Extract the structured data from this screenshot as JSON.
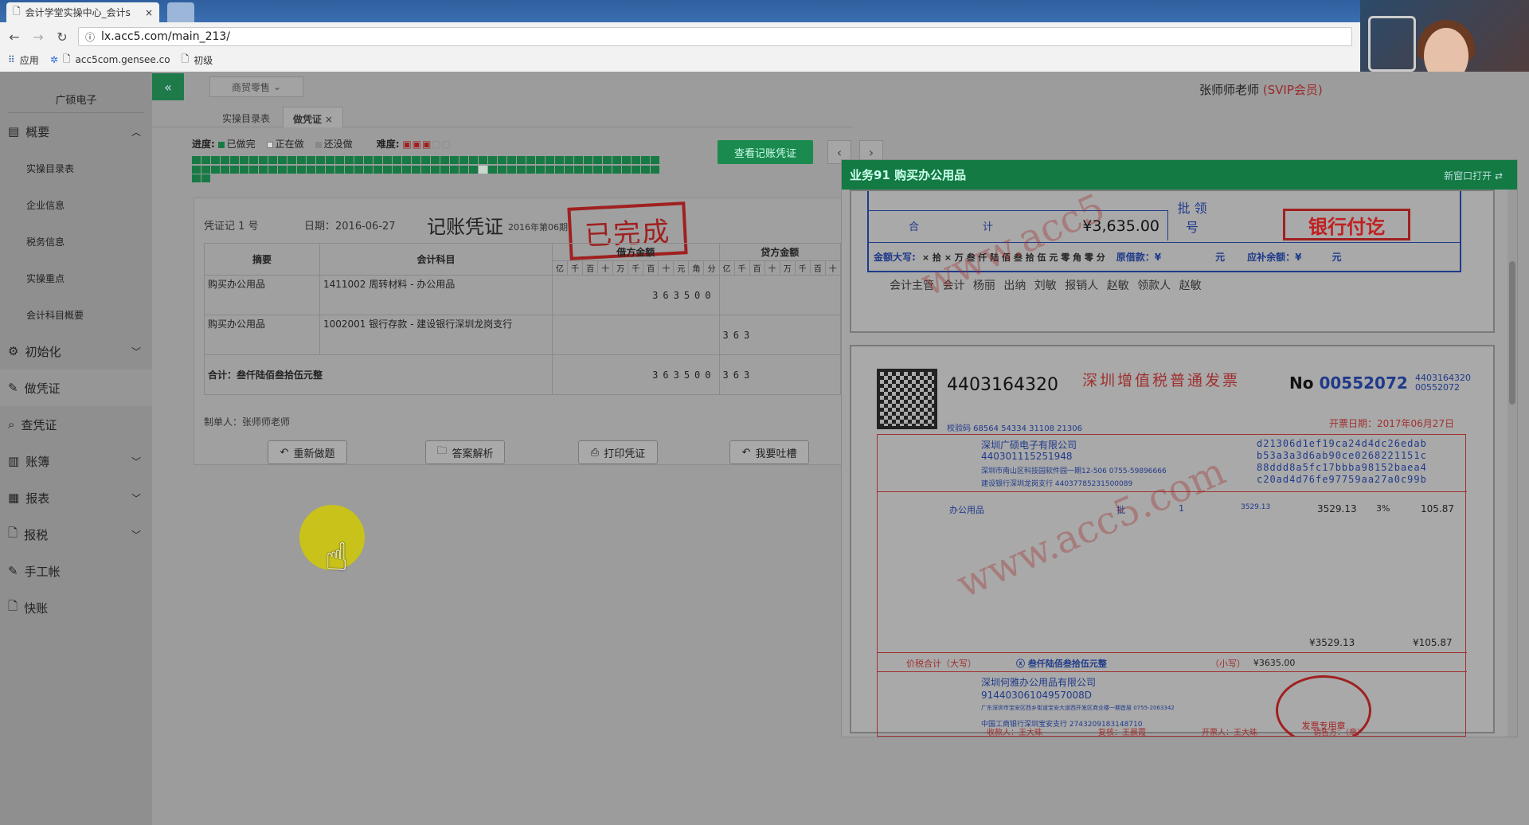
{
  "browser": {
    "tabs": [
      {
        "title": "会计学堂实操中心_会计s"
      }
    ],
    "url": "lx.acc5.com/main_213/",
    "bookmarks": [
      "应用",
      "acc5com.gensee.co",
      "初级"
    ]
  },
  "sidebar": {
    "brand": "广硕电子",
    "items": [
      {
        "label": "概要",
        "icon": "grid-icon",
        "expanded": true
      },
      {
        "label": "初始化",
        "icon": "gear-icon"
      },
      {
        "label": "做凭证",
        "icon": "pen-icon"
      },
      {
        "label": "查凭证",
        "icon": "search-icon"
      },
      {
        "label": "账簿",
        "icon": "book-icon"
      },
      {
        "label": "报表",
        "icon": "report-icon"
      },
      {
        "label": "报税",
        "icon": "file-icon"
      },
      {
        "label": "手工帐",
        "icon": "pen-icon"
      },
      {
        "label": "快账",
        "icon": "file-icon"
      }
    ],
    "sub_items": [
      "实操目录表",
      "企业信息",
      "税务信息",
      "实操重点",
      "会计科目概要"
    ]
  },
  "header": {
    "industry": "商贸零售",
    "teacher": "张师师老师",
    "vip": "(SVIP会员)"
  },
  "subtabs": [
    "实操目录表",
    "做凭证"
  ],
  "progress": {
    "label": "进度:",
    "done": "已做完",
    "doing": "正在做",
    "todo": "还没做",
    "difficulty_label": "难度:",
    "total_cells": 100,
    "current_cell": 79
  },
  "buttons": {
    "view_voucher": "查看记账凭证",
    "redo": "重新做题",
    "answer": "答案解析",
    "print": "打印凭证",
    "complain": "我要吐槽"
  },
  "voucher": {
    "no": "凭证记 1 号",
    "date": "日期：2016-06-27",
    "title": "记账凭证",
    "period": "2016年第06期",
    "stamp": "已完成",
    "headers": {
      "summary": "摘要",
      "account": "会计科目",
      "debit": "借方金额",
      "credit": "贷方金额"
    },
    "digit_units": [
      "亿",
      "千",
      "百",
      "十",
      "万",
      "千",
      "百",
      "十",
      "元",
      "角",
      "分"
    ],
    "rows": [
      {
        "summary": "购买办公用品",
        "account": "1411002 周转材料 - 办公用品",
        "debit": "363500",
        "credit": ""
      },
      {
        "summary": "购买办公用品",
        "account": "1002001 银行存款 - 建设银行深圳龙岗支行",
        "debit": "",
        "credit": "363"
      }
    ],
    "total_label": "合计：叁仟陆佰叁拾伍元整",
    "total_debit": "363500",
    "total_credit": "363",
    "maker": "制单人：张师师老师"
  },
  "right_panel": {
    "title": "业务91 购买办公用品",
    "new_window": "新窗口打开",
    "doc1": {
      "row1_left": "合",
      "row1_mid": "计",
      "amount": "¥3,635.00",
      "approve": "批 领 号",
      "bank_stamp": "银行付讫",
      "words_label": "金额大写:",
      "words": "× 拾 × 万 叁 仟 陆 佰 叁 拾 伍 元 零 角 零 分",
      "loan_label": "原借款：¥",
      "loan_unit": "元",
      "refund_label": "应补余额：¥",
      "refund_unit": "元",
      "signers": "会计主管  会计 杨丽  出纳 刘敏  报销人 赵敏  领款人 赵敏",
      "watermark": "www.acc5"
    },
    "doc2": {
      "code": "4403164320",
      "title": "深圳增值税普通发票",
      "no_label": "No",
      "no": "00552072",
      "no_small": "4403164320\n00552072",
      "date": "开票日期：2017年06月27日",
      "check": "校验码 68564 54334 31108 21306",
      "buyer": "深圳广硕电子有限公司",
      "buyer_tax": "440301115251948",
      "buyer_addr": "深圳市南山区科技园软件园一期12-506 0755-59896666",
      "buyer_bank": "建设银行深圳龙岗支行 44037785231500089",
      "cipher": "d21306d1ef19ca24d4dc26edab\nb53a3a3d6ab90ce0268221151c\n88ddd8a5fc17bbba98152baea4\nc20ad4d76fe97759aa27a0c99b",
      "item": "办公用品",
      "unit": "批",
      "qty": "1",
      "price": "3529.13",
      "amount": "3529.13",
      "rate": "3%",
      "tax": "105.87",
      "total_amount": "¥3529.13",
      "total_tax": "¥105.87",
      "total_words_label": "价税合计（大写）",
      "total_words": "ⓧ 叁仟陆佰叁拾伍元整",
      "small_label": "（小写）",
      "small": "¥3635.00",
      "seller": "深圳何雅办公用品有限公司",
      "seller_tax": "91440306104957008D",
      "seller_addr": "广东深圳市宝安区西乡街道宝安大道西开发区商业楼一期首层 0755-2063342",
      "seller_bank": "中国工商银行深圳宝安支行 2743209183148710",
      "payee": "收款人：王大珠",
      "reviewer": "复核：王晨霞",
      "drawer": "开票人：王大珠",
      "seller_label": "销售方：（章）",
      "stamp": "发票专用章",
      "watermark": "www.acc5.com"
    }
  },
  "colors": {
    "accent": "#1b8a4e",
    "stamp": "#a02020"
  }
}
